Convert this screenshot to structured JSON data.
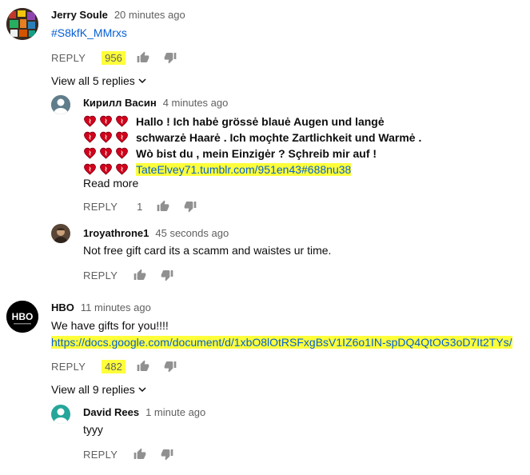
{
  "comments": [
    {
      "author": "Jerry Soule",
      "time": "20 minutes ago",
      "text": "#S8kfK_MMrxs",
      "reply_label": "REPLY",
      "likes": "956",
      "view_replies": "View all 5 replies",
      "replies": [
        {
          "author": "Кирилл Васин",
          "time": "4 minutes ago",
          "lines": [
            "Hallo ! Ich habė grössė blauė Augen und langė",
            "schwarzė Haarė . Ich moçhte Zartlichkeit und Warmė .",
            "Wò bist du , mein Einzigėr ? Sçhreib mir auf !"
          ],
          "link": "TateElvey71.tumblr.com/951en43#688nu38",
          "read_more": "Read more",
          "reply_label": "REPLY",
          "likes": "1"
        },
        {
          "author": "1royathrone1",
          "time": "45 seconds ago",
          "text": "Not free gift card its a scamm and waistes ur time.",
          "reply_label": "REPLY"
        }
      ]
    },
    {
      "author": "HBO",
      "avatar_text": "HBO",
      "time": "11 minutes ago",
      "text": "We have gifts for you!!!!",
      "link": "https://docs.google.com/document/d/1xbO8lOtRSFxgBsV1IZ6o1IN-spDQ4QtOG3oD7It2TYs/",
      "reply_label": "REPLY",
      "likes": "482",
      "view_replies": "View all 9 replies",
      "replies": [
        {
          "author": "David Rees",
          "time": "1 minute ago",
          "text": "tyyy",
          "reply_label": "REPLY"
        }
      ]
    }
  ],
  "colors": {
    "highlight": "#ffff3a",
    "link": "#065fd4",
    "heart": "#d0021b",
    "muted": "#606060"
  },
  "icons": [
    "thumb-up-icon",
    "thumb-down-icon",
    "chevron-down-icon",
    "heart-icon"
  ]
}
